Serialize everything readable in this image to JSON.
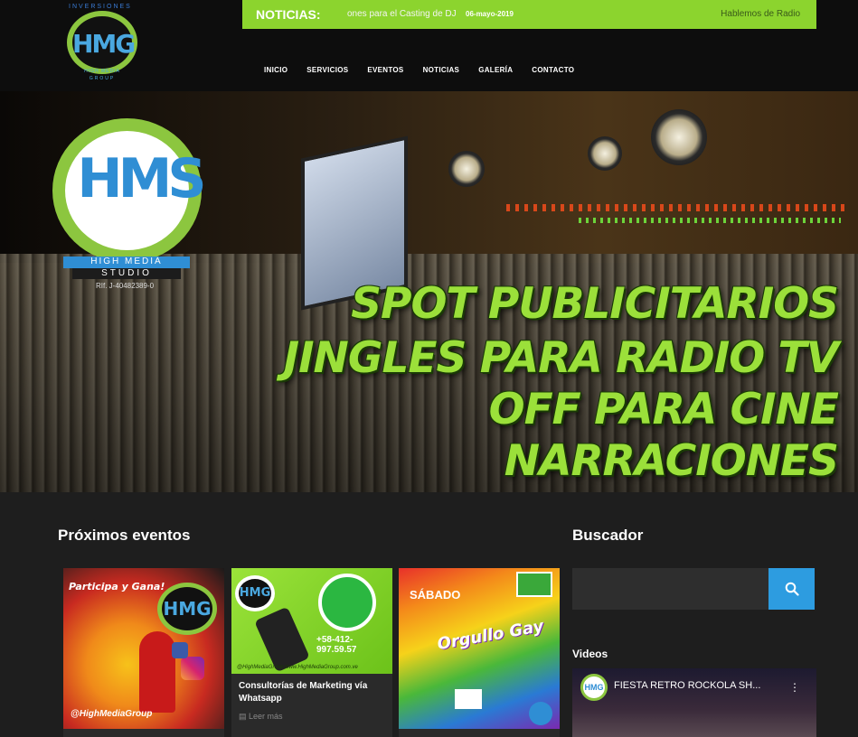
{
  "header": {
    "logo_top": "INVERSIONES",
    "logo_text": "HMG",
    "logo_sub": "HIGH MEDIA",
    "logo_sub2": "GROUP",
    "ticker": {
      "label": "NOTICIAS:",
      "text": "ones para el Casting de DJ",
      "date": "06-mayo-2019",
      "right": "Hablemos de Radio"
    },
    "nav": [
      "INICIO",
      "SERVICIOS",
      "EVENTOS",
      "NOTICIAS",
      "GALERÍA",
      "CONTACTO"
    ]
  },
  "hero": {
    "logo_text": "HMS",
    "logo_band1": "HIGH MEDIA",
    "logo_band2": "STUDIO",
    "logo_rif": "RIf. J-40482389-0",
    "lines": [
      "SPOT PUBLICITARIOS",
      "JINGLES PARA RADIO TV",
      "OFF PARA CINE",
      "NARRACIONES"
    ]
  },
  "events": {
    "title": "Próximos eventos",
    "cards": [
      {
        "image_text": "Participa y Gana!",
        "image_sub": "@HighMediaGroup",
        "title": "",
        "more": ""
      },
      {
        "image_text": "+58-412-997.59.57",
        "image_sub": "@HighMediaGroup  www.HighMediaGroup.com.ve",
        "title": "Consultorías de Marketing vía Whatsapp",
        "more": "Leer más"
      },
      {
        "image_text": "Orgullo Gay",
        "image_sub": "SÁBADO",
        "title": "",
        "more": ""
      }
    ]
  },
  "sidebar": {
    "search_title": "Buscador",
    "search_placeholder": "",
    "videos_label": "Videos",
    "video_title": "FIESTA RETRO ROCKOLA SH..."
  },
  "colors": {
    "accent_green": "#8cd42e",
    "accent_blue": "#2d9ce0"
  }
}
